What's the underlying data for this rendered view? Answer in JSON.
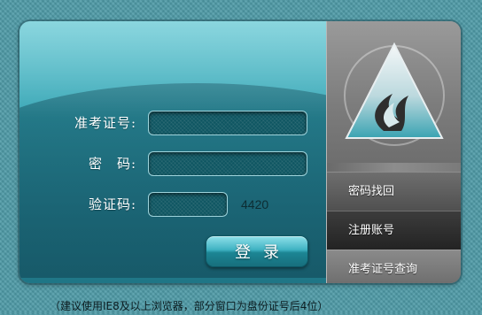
{
  "form": {
    "exam_id_label": "准考证号:",
    "password_label": "密　码:",
    "captcha_label": "验证码:",
    "exam_id_value": "",
    "password_value": "",
    "captcha_value": "",
    "captcha_code": "4420",
    "login_label": "登录"
  },
  "menu": {
    "items": [
      {
        "label": "密码找回"
      },
      {
        "label": "注册账号"
      },
      {
        "label": "准考证号查询"
      }
    ]
  },
  "logo": {
    "icon": "triangle-flame-logo-icon"
  },
  "footer": {
    "note": "（建议使用IE8及以上浏览器，部分窗口为盘份证号后4位）"
  },
  "colors": {
    "panel_teal": "#3aa7b6",
    "menu_gray": "#6e6e6e",
    "menu_dark": "#232323"
  }
}
